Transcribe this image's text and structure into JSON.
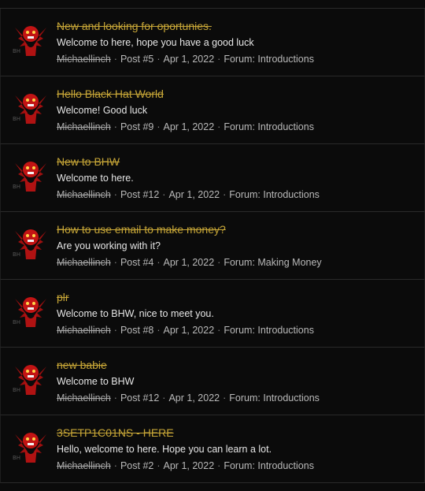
{
  "results": [
    {
      "title": "New and looking for oportunies.",
      "snippet": "Welcome to here, hope you have a good luck",
      "user": "Michaellinch",
      "post": "Post #5",
      "date": "Apr 1, 2022",
      "forum": "Forum: Introductions"
    },
    {
      "title": "Hello Black Hat World",
      "snippet": "Welcome! Good luck",
      "user": "Michaellinch",
      "post": "Post #9",
      "date": "Apr 1, 2022",
      "forum": "Forum: Introductions"
    },
    {
      "title": "New to BHW",
      "snippet": "Welcome to here.",
      "user": "Michaellinch",
      "post": "Post #12",
      "date": "Apr 1, 2022",
      "forum": "Forum: Introductions"
    },
    {
      "title": "How to use email to make money?",
      "snippet": "Are you working with it?",
      "user": "Michaellinch",
      "post": "Post #4",
      "date": "Apr 1, 2022",
      "forum": "Forum: Making Money"
    },
    {
      "title": "plr",
      "snippet": "Welcome to BHW, nice to meet you.",
      "user": "Michaellinch",
      "post": "Post #8",
      "date": "Apr 1, 2022",
      "forum": "Forum: Introductions"
    },
    {
      "title": "new babie",
      "snippet": "Welcome to BHW",
      "user": "Michaellinch",
      "post": "Post #12",
      "date": "Apr 1, 2022",
      "forum": "Forum: Introductions"
    },
    {
      "title": "3SETP1C01NS - HERE",
      "snippet": "Hello, welcome to here. Hope you can learn a lot.",
      "user": "Michaellinch",
      "post": "Post #2",
      "date": "Apr 1, 2022",
      "forum": "Forum: Introductions"
    }
  ],
  "separator": "·",
  "avatar_icon": "red-winged-creature-avatar",
  "colors": {
    "background": "#0b0b0b",
    "title": "#c7a637",
    "snippet": "#e6e6e6",
    "meta": "#b9b9b9",
    "divider": "#2a2a2a"
  }
}
